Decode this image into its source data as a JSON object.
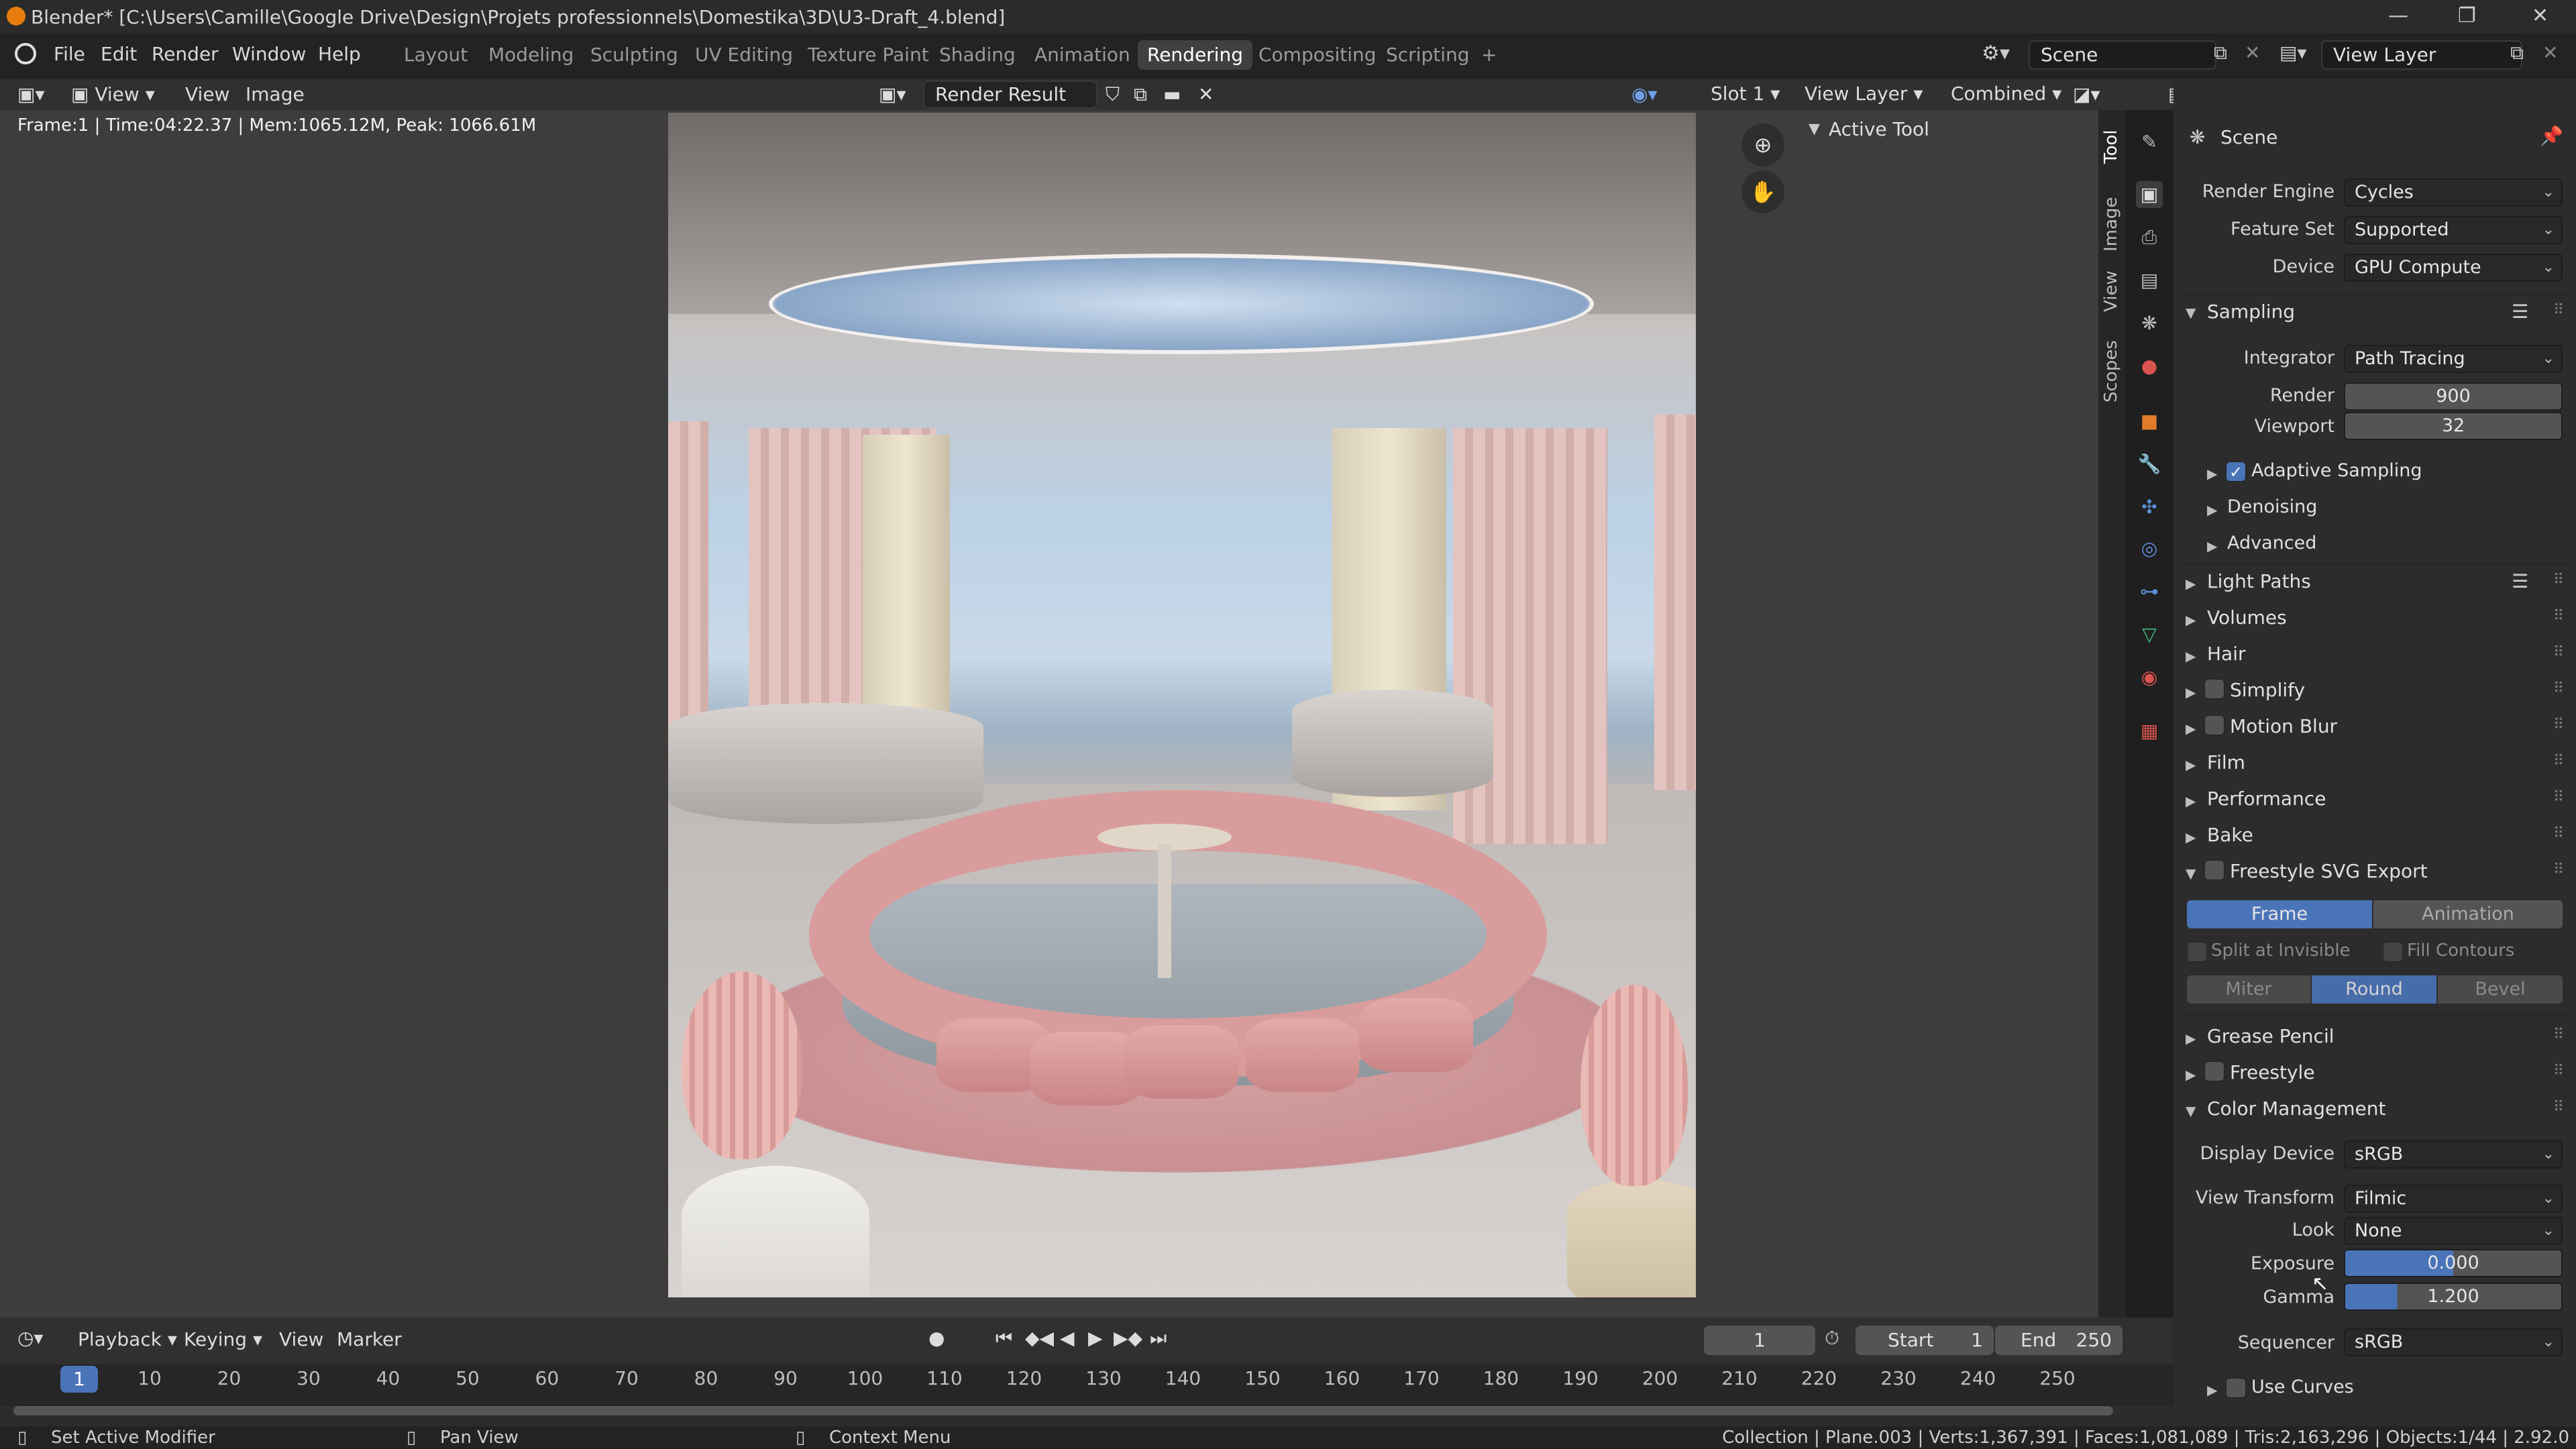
{
  "window": {
    "title": "Blender* [C:\\Users\\Camille\\Google Drive\\Design\\Projets professionnels\\Domestika\\3D\\U3-Draft_4.blend]",
    "controls": [
      "minimize-icon",
      "restore-icon",
      "close-icon"
    ]
  },
  "menu": [
    "File",
    "Edit",
    "Render",
    "Window",
    "Help"
  ],
  "workspaces": [
    "Layout",
    "Modeling",
    "Sculpting",
    "UV Editing",
    "Texture Paint",
    "Shading",
    "Animation",
    "Rendering",
    "Compositing",
    "Scripting"
  ],
  "active_workspace": "Rendering",
  "scene_field": "Scene",
  "view_layer_field": "View Layer",
  "image_editor": {
    "view_menu": "View",
    "menus": [
      "View",
      "Image"
    ],
    "image_name": "Render Result",
    "slot": "Slot 1",
    "layer": "View Layer",
    "pass": "Combined"
  },
  "viewport": {
    "frame_info": "Frame:1 | Time:04:22.37 | Mem:1065.12M, Peak: 1066.61M",
    "active_tool": "Active Tool"
  },
  "side_tabs": [
    "Tool",
    "Image",
    "View",
    "Scopes"
  ],
  "properties": {
    "header": "Scene",
    "render_engine": {
      "label": "Render Engine",
      "value": "Cycles"
    },
    "feature_set": {
      "label": "Feature Set",
      "value": "Supported"
    },
    "device": {
      "label": "Device",
      "value": "GPU Compute"
    },
    "sampling": {
      "title": "Sampling",
      "integrator": {
        "label": "Integrator",
        "value": "Path Tracing"
      },
      "render": {
        "label": "Render",
        "value": "900"
      },
      "viewport": {
        "label": "Viewport",
        "value": "32"
      },
      "adaptive": "Adaptive Sampling",
      "denoising": "Denoising",
      "advanced": "Advanced"
    },
    "panels": [
      "Light Paths",
      "Volumes",
      "Hair",
      "Simplify",
      "Motion Blur",
      "Film",
      "Performance",
      "Bake"
    ],
    "freestyle_svg": {
      "title": "Freestyle SVG Export",
      "mode": [
        "Frame",
        "Animation"
      ],
      "split_invisible": "Split at Invisible",
      "fill_contours": "Fill Contours",
      "join": [
        "Miter",
        "Round",
        "Bevel"
      ]
    },
    "grease_pencil": "Grease Pencil",
    "freestyle": "Freestyle",
    "color_management": {
      "title": "Color Management",
      "display_device": {
        "label": "Display Device",
        "value": "sRGB"
      },
      "view_transform": {
        "label": "View Transform",
        "value": "Filmic"
      },
      "look": {
        "label": "Look",
        "value": "None"
      },
      "exposure": {
        "label": "Exposure",
        "value": "0.000"
      },
      "gamma": {
        "label": "Gamma",
        "value": "1.200"
      },
      "sequencer": {
        "label": "Sequencer",
        "value": "sRGB"
      },
      "use_curves": "Use Curves"
    }
  },
  "timeline": {
    "menus": [
      "Playback",
      "Keying",
      "View",
      "Marker"
    ],
    "current_frame": "1",
    "start_label": "Start",
    "start": "1",
    "end_label": "End",
    "end": "250",
    "ticks": [
      "10",
      "20",
      "30",
      "40",
      "50",
      "60",
      "70",
      "80",
      "90",
      "100",
      "110",
      "120",
      "130",
      "140",
      "150",
      "160",
      "170",
      "180",
      "190",
      "200",
      "210",
      "220",
      "230",
      "240",
      "250"
    ]
  },
  "statusbar": {
    "left": "Set Active Modifier",
    "mid": "Pan View",
    "right_hint": "Context Menu",
    "stats": "Collection | Plane.003 | Verts:1,367,391 | Faces:1,081,089 | Tris:2,163,296 | Objects:1/44 | 2.92.0"
  }
}
